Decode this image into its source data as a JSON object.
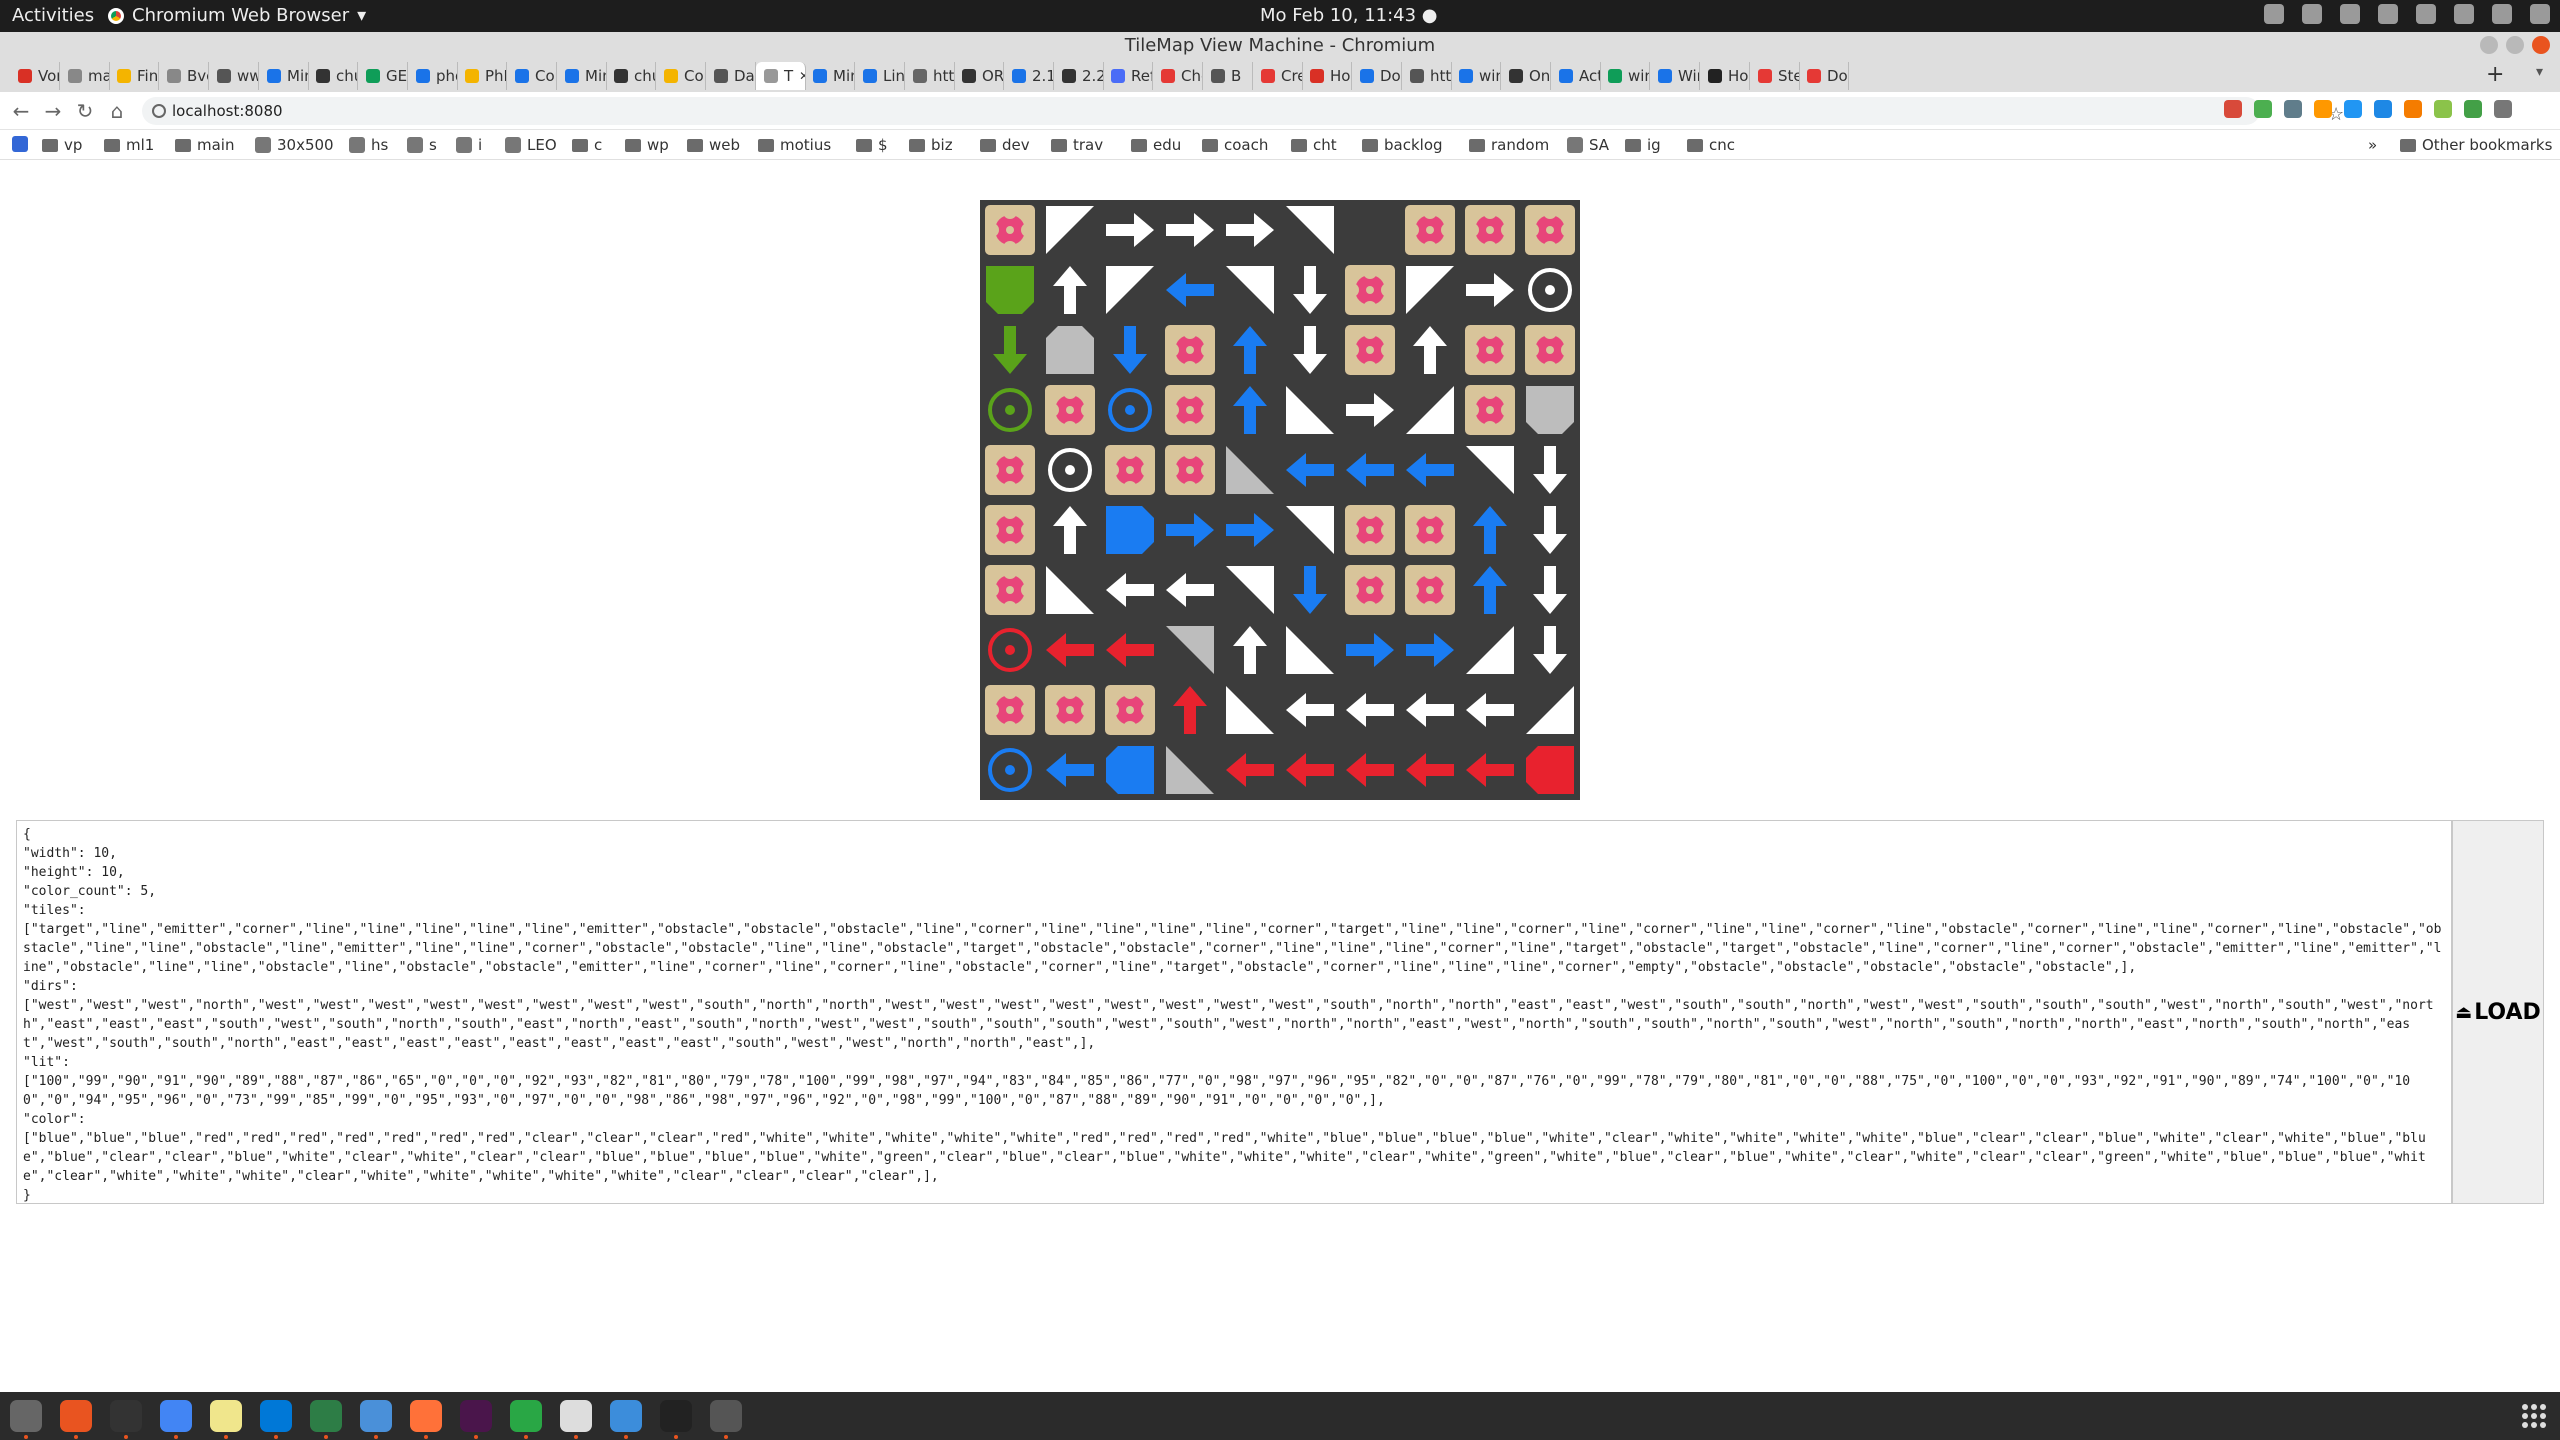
{
  "gnome": {
    "activities": "Activities",
    "app_name": "Chromium Web Browser",
    "app_arrow": "▾",
    "clock": "Mo Feb 10, 11:43 ●"
  },
  "window": {
    "title": "TileMap View Machine - Chromium"
  },
  "tabs": [
    "Vor",
    "mai",
    "Find",
    "Bvc",
    "ww",
    "Min",
    "chu",
    "GEC",
    "phd",
    "PhD",
    "Con",
    "Min",
    "chu",
    "Con",
    "Dail",
    "T",
    "Min",
    "Line",
    "http",
    "OR-",
    "2.1.",
    "2.2.",
    "Refe",
    "Che",
    "B",
    "Cre",
    "How",
    "Dov",
    "http",
    "win",
    "Onc",
    "Acti",
    "win",
    "Win",
    "How",
    "Step",
    "Dov"
  ],
  "active_tab_index": 15,
  "new_tab_label": "+",
  "url": "localhost:8080",
  "bookmarks": [
    {
      "label": "vp",
      "type": "folder"
    },
    {
      "label": "ml1",
      "type": "folder"
    },
    {
      "label": "main",
      "type": "folder"
    },
    {
      "label": "30x500",
      "type": "link"
    },
    {
      "label": "hs",
      "type": "link"
    },
    {
      "label": "s",
      "type": "link"
    },
    {
      "label": "i",
      "type": "link"
    },
    {
      "label": "LEO",
      "type": "link"
    },
    {
      "label": "c",
      "type": "folder"
    },
    {
      "label": "wp",
      "type": "folder"
    },
    {
      "label": "web",
      "type": "folder"
    },
    {
      "label": "motius",
      "type": "folder"
    },
    {
      "label": "$",
      "type": "folder"
    },
    {
      "label": "biz",
      "type": "folder"
    },
    {
      "label": "dev",
      "type": "folder"
    },
    {
      "label": "trav",
      "type": "folder"
    },
    {
      "label": "edu",
      "type": "folder"
    },
    {
      "label": "coach",
      "type": "folder"
    },
    {
      "label": "cht",
      "type": "folder"
    },
    {
      "label": "backlog",
      "type": "folder"
    },
    {
      "label": "random",
      "type": "folder"
    },
    {
      "label": "SA",
      "type": "link"
    },
    {
      "label": "ig",
      "type": "folder"
    },
    {
      "label": "cnc",
      "type": "folder"
    }
  ],
  "bookmarks_more": "»",
  "other_bookmarks": "Other bookmarks",
  "colors": {
    "board_bg": "#3c3c3c",
    "obstacle_bg": "#d8c49a",
    "obstacle_fg": "#e8457a",
    "white": "#ffffff",
    "blue": "#1a7cf2",
    "red": "#e8222e",
    "green": "#5aa31a",
    "clear": "#bdbdbd"
  },
  "tilemap": {
    "width": 10,
    "height": 10,
    "cells": [
      [
        "obstacle",
        "corner:w:white",
        "arrow:e:white",
        "arrow:e:white",
        "arrow:e:white",
        "corner:n:white",
        "empty",
        "obstacle",
        "obstacle",
        "obstacle"
      ],
      [
        "emitter:s:green",
        "arrow:n:white",
        "corner:w:white",
        "arrow:w:blue",
        "corner:n:white",
        "arrow:s:white",
        "obstacle",
        "corner:w:white",
        "arrow:e:white",
        "target:white"
      ],
      [
        "arrow:s:green",
        "emitter:n:clear",
        "arrow:s:blue",
        "obstacle",
        "arrow:n:blue",
        "arrow:s:white",
        "obstacle",
        "arrow:n:white",
        "obstacle",
        "obstacle"
      ],
      [
        "target:green",
        "obstacle",
        "target:blue",
        "obstacle",
        "arrow:n:blue",
        "corner:s:white",
        "arrow:e:white",
        "corner:e:white",
        "obstacle",
        "emitter:s:clear"
      ],
      [
        "obstacle",
        "target:white",
        "obstacle",
        "obstacle",
        "corner:s:clear",
        "arrow:w:blue",
        "arrow:w:blue",
        "arrow:w:blue",
        "corner:n:white",
        "arrow:s:white"
      ],
      [
        "obstacle",
        "arrow:n:white",
        "emitter:e:blue",
        "arrow:e:blue",
        "arrow:e:blue",
        "corner:n:white",
        "obstacle",
        "obstacle",
        "arrow:n:blue",
        "arrow:s:white"
      ],
      [
        "obstacle",
        "corner:s:white",
        "arrow:w:white",
        "arrow:w:white",
        "corner:n:white",
        "arrow:s:blue",
        "obstacle",
        "obstacle",
        "arrow:n:blue",
        "arrow:s:white"
      ],
      [
        "target:red",
        "arrow:w:red",
        "arrow:w:red",
        "corner:n:clear",
        "arrow:n:white",
        "corner:s:white",
        "arrow:e:blue",
        "arrow:e:blue",
        "corner:e:white",
        "arrow:s:white"
      ],
      [
        "obstacle",
        "obstacle",
        "obstacle",
        "arrow:n:red",
        "corner:s:white",
        "arrow:w:white",
        "arrow:w:white",
        "arrow:w:white",
        "arrow:w:white",
        "corner:e:white"
      ],
      [
        "target:blue",
        "arrow:w:blue",
        "emitter:w:blue",
        "corner:s:clear",
        "arrow:w:red",
        "arrow:w:red",
        "arrow:w:red",
        "arrow:w:red",
        "arrow:w:red",
        "emitter:w:red"
      ]
    ]
  },
  "json_text": "{\n\"width\": 10,\n\"height\": 10,\n\"color_count\": 5,\n\"tiles\":\n[\"target\",\"line\",\"emitter\",\"corner\",\"line\",\"line\",\"line\",\"line\",\"line\",\"emitter\",\"obstacle\",\"obstacle\",\"obstacle\",\"line\",\"corner\",\"line\",\"line\",\"line\",\"line\",\"corner\",\"target\",\"line\",\"line\",\"corner\",\"line\",\"corner\",\"line\",\"line\",\"corner\",\"line\",\"obstacle\",\"corner\",\"line\",\"line\",\"corner\",\"line\",\"obstacle\",\"obstacle\",\"line\",\"line\",\"obstacle\",\"line\",\"emitter\",\"line\",\"line\",\"corner\",\"obstacle\",\"obstacle\",\"line\",\"line\",\"obstacle\",\"target\",\"obstacle\",\"obstacle\",\"corner\",\"line\",\"line\",\"line\",\"corner\",\"line\",\"target\",\"obstacle\",\"target\",\"obstacle\",\"line\",\"corner\",\"line\",\"corner\",\"obstacle\",\"emitter\",\"line\",\"emitter\",\"line\",\"obstacle\",\"line\",\"line\",\"obstacle\",\"line\",\"obstacle\",\"obstacle\",\"emitter\",\"line\",\"corner\",\"line\",\"corner\",\"line\",\"obstacle\",\"corner\",\"line\",\"target\",\"obstacle\",\"corner\",\"line\",\"line\",\"line\",\"corner\",\"empty\",\"obstacle\",\"obstacle\",\"obstacle\",\"obstacle\",\"obstacle\",],\n\"dirs\":\n[\"west\",\"west\",\"west\",\"north\",\"west\",\"west\",\"west\",\"west\",\"west\",\"west\",\"west\",\"west\",\"south\",\"north\",\"north\",\"west\",\"west\",\"west\",\"west\",\"west\",\"west\",\"west\",\"west\",\"south\",\"north\",\"north\",\"east\",\"east\",\"west\",\"south\",\"south\",\"north\",\"west\",\"west\",\"south\",\"south\",\"south\",\"west\",\"north\",\"south\",\"west\",\"north\",\"east\",\"east\",\"east\",\"south\",\"west\",\"south\",\"north\",\"south\",\"east\",\"north\",\"east\",\"south\",\"north\",\"west\",\"west\",\"south\",\"south\",\"south\",\"west\",\"south\",\"west\",\"north\",\"north\",\"east\",\"west\",\"north\",\"south\",\"south\",\"north\",\"south\",\"west\",\"north\",\"south\",\"north\",\"north\",\"east\",\"north\",\"south\",\"north\",\"east\",\"west\",\"south\",\"south\",\"north\",\"east\",\"east\",\"east\",\"east\",\"east\",\"east\",\"east\",\"east\",\"south\",\"west\",\"west\",\"north\",\"north\",\"east\",],\n\"lit\":\n[\"100\",\"99\",\"90\",\"91\",\"90\",\"89\",\"88\",\"87\",\"86\",\"65\",\"0\",\"0\",\"0\",\"92\",\"93\",\"82\",\"81\",\"80\",\"79\",\"78\",\"100\",\"99\",\"98\",\"97\",\"94\",\"83\",\"84\",\"85\",\"86\",\"77\",\"0\",\"98\",\"97\",\"96\",\"95\",\"82\",\"0\",\"0\",\"87\",\"76\",\"0\",\"99\",\"78\",\"79\",\"80\",\"81\",\"0\",\"0\",\"88\",\"75\",\"0\",\"100\",\"0\",\"0\",\"93\",\"92\",\"91\",\"90\",\"89\",\"74\",\"100\",\"0\",\"100\",\"0\",\"94\",\"95\",\"96\",\"0\",\"73\",\"99\",\"85\",\"99\",\"0\",\"95\",\"93\",\"0\",\"97\",\"0\",\"0\",\"98\",\"86\",\"98\",\"97\",\"96\",\"92\",\"0\",\"98\",\"99\",\"100\",\"0\",\"87\",\"88\",\"89\",\"90\",\"91\",\"0\",\"0\",\"0\",\"0\",],\n\"color\":\n[\"blue\",\"blue\",\"blue\",\"red\",\"red\",\"red\",\"red\",\"red\",\"red\",\"red\",\"clear\",\"clear\",\"clear\",\"red\",\"white\",\"white\",\"white\",\"white\",\"white\",\"red\",\"red\",\"red\",\"red\",\"white\",\"blue\",\"blue\",\"blue\",\"blue\",\"white\",\"clear\",\"white\",\"white\",\"white\",\"white\",\"blue\",\"clear\",\"clear\",\"blue\",\"white\",\"clear\",\"white\",\"blue\",\"blue\",\"blue\",\"clear\",\"clear\",\"blue\",\"white\",\"clear\",\"white\",\"clear\",\"clear\",\"blue\",\"blue\",\"blue\",\"blue\",\"white\",\"green\",\"clear\",\"blue\",\"clear\",\"blue\",\"white\",\"white\",\"white\",\"clear\",\"white\",\"green\",\"white\",\"blue\",\"clear\",\"blue\",\"white\",\"clear\",\"white\",\"clear\",\"clear\",\"green\",\"white\",\"blue\",\"blue\",\"blue\",\"white\",\"clear\",\"white\",\"white\",\"white\",\"clear\",\"white\",\"white\",\"white\",\"white\",\"white\",\"clear\",\"clear\",\"clear\",\"clear\",],\n}",
  "load_label": "LOAD",
  "load_icon": "⏏"
}
